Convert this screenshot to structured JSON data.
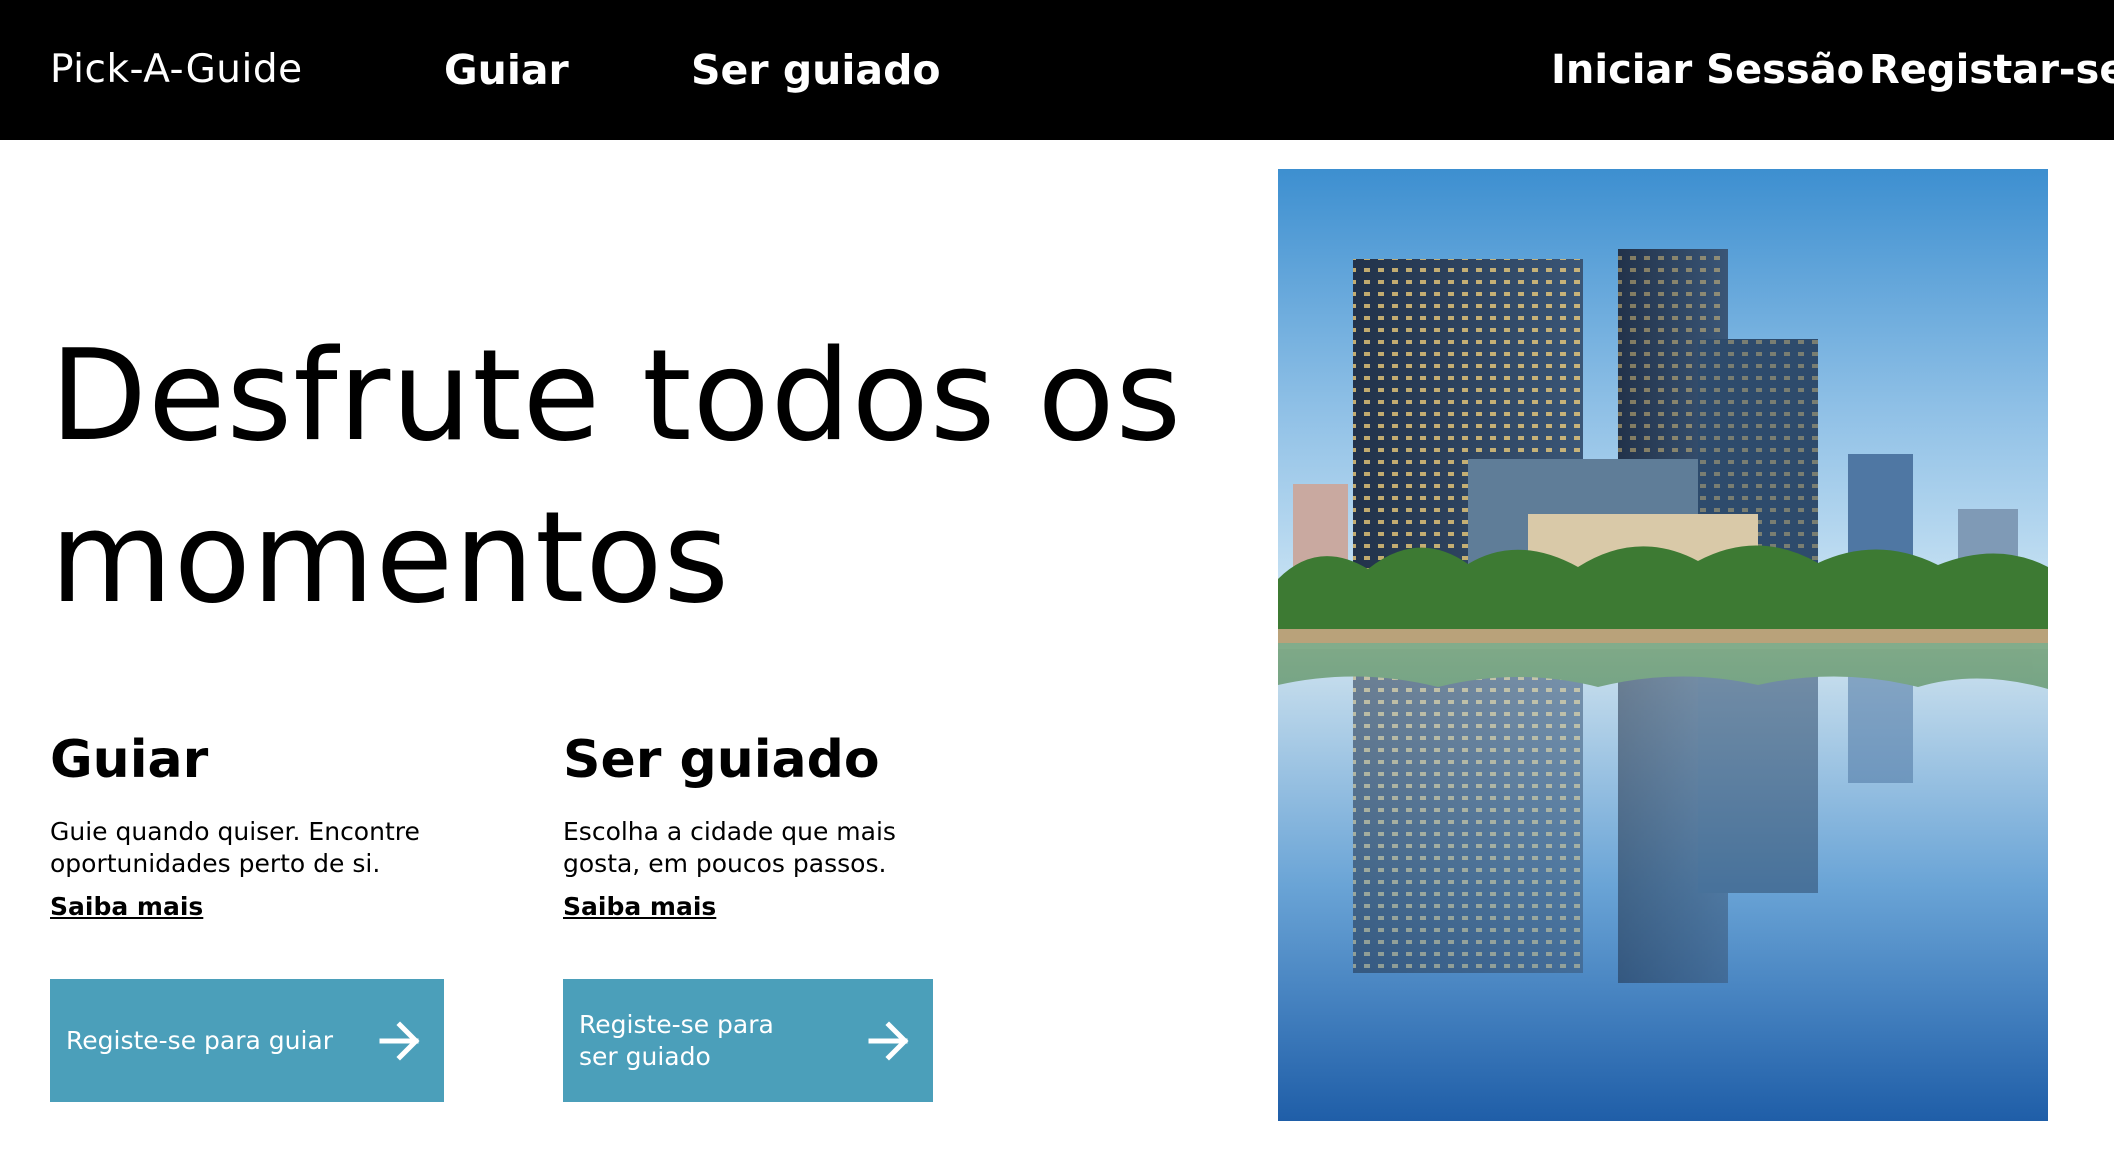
{
  "header": {
    "logo": "Pick-A-Guide",
    "nav": {
      "guiar": "Guiar",
      "ser_guiado": "Ser guiado"
    },
    "login": "Iniciar Sessão",
    "register": "Registar-se"
  },
  "hero": {
    "title": "Desfrute todos os momentos"
  },
  "guiar": {
    "heading": "Guiar",
    "text": "Guie quando quiser. Encontre oportunidades perto de si.",
    "more": "Saiba mais",
    "cta": "Registe-se para guiar"
  },
  "ser_guiado": {
    "heading": "Ser guiado",
    "text": "Escolha a cidade que mais gosta, em poucos passos.",
    "more": "Saiba mais",
    "cta": "Registe-se para ser guiado"
  },
  "colors": {
    "header_bg": "#000000",
    "cta_bg": "#4b9fba",
    "text": "#000000"
  },
  "icons": {
    "cta_arrow": "arrow-right-icon"
  }
}
